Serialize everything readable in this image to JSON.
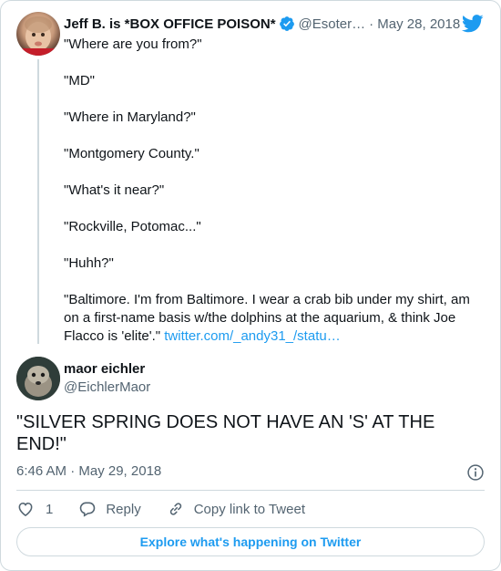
{
  "parent_tweet": {
    "author_name": "Jeff B. is *BOX OFFICE POISON*",
    "handle": "@Esoter…",
    "date": "· May 28, 2018",
    "lines": [
      "\"Where are you from?\"",
      "\"MD\"",
      "\"Where in Maryland?\"",
      "\"Montgomery County.\"",
      "\"What's it near?\"",
      "\"Rockville, Potomac...\"",
      "\"Huhh?\""
    ],
    "final_text": "\"Baltimore. I'm from Baltimore. I wear a crab bib under my shirt, am on a first-name basis w/the dolphins at the aquarium, & think Joe Flacco is 'elite'.\"",
    "link_text": "twitter.com/_andy31_/statu…"
  },
  "main_tweet": {
    "author_name": "maor eichler",
    "handle": "@EichlerMaor",
    "text": "\"SILVER SPRING DOES NOT HAVE AN 'S' AT THE END!\"",
    "timestamp": "6:46 AM · May 29, 2018"
  },
  "actions": {
    "like_count": "1",
    "reply_label": "Reply",
    "copy_link_label": "Copy link to Tweet"
  },
  "explore_button_label": "Explore what's happening on Twitter",
  "icons": {
    "verified": "verified-badge-icon",
    "brand": "twitter-bird-icon",
    "info": "info-icon",
    "like": "heart-icon",
    "reply": "reply-bubble-icon",
    "link": "link-icon"
  },
  "colors": {
    "accent": "#1d9bf0",
    "text": "#0f1419",
    "secondary": "#536471",
    "border": "#cfd9de"
  }
}
